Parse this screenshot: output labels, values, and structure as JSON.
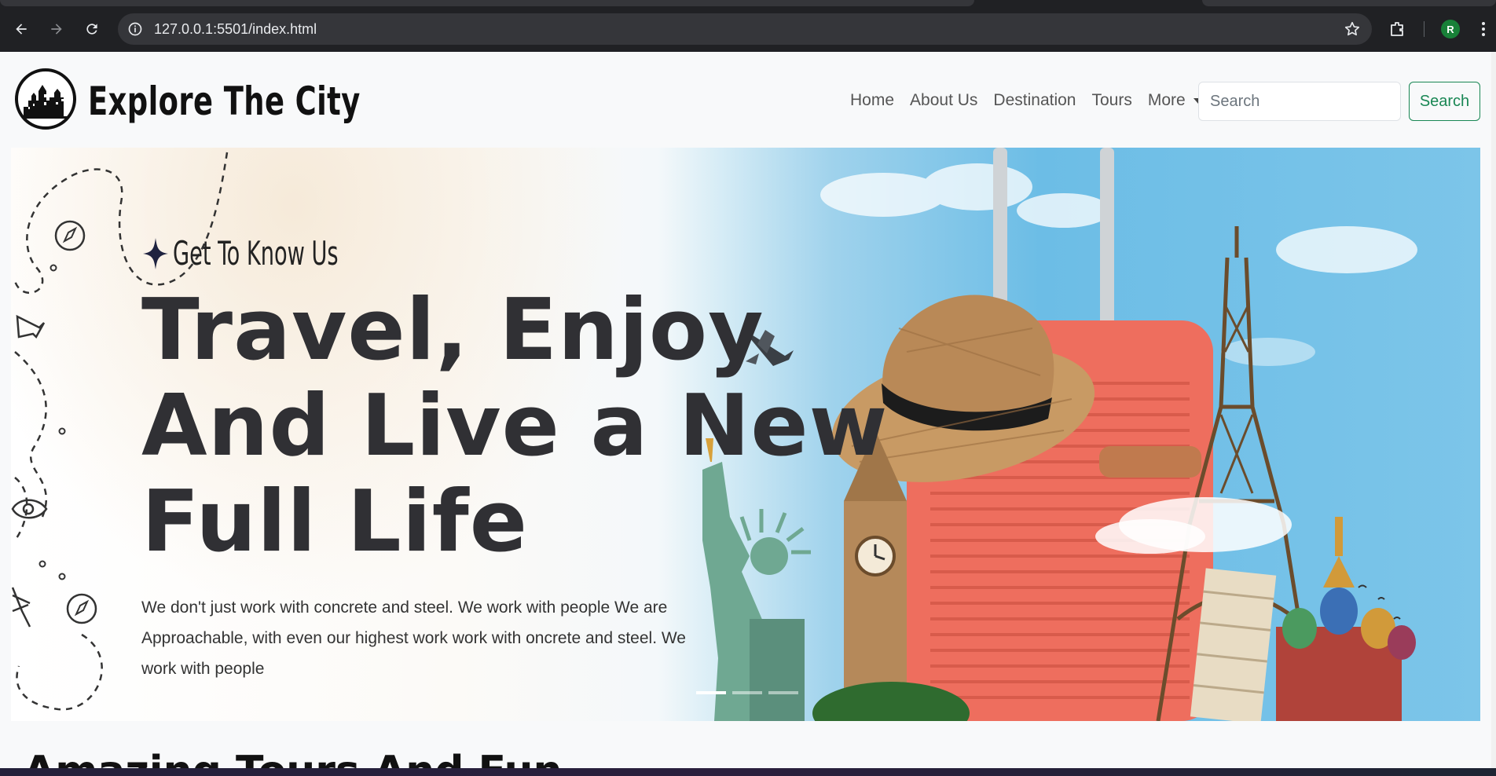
{
  "browser": {
    "url": "127.0.0.1:5501/index.html",
    "profile_initial": "R",
    "profile_color": "#188038"
  },
  "navbar": {
    "brand": "Explore The City",
    "links": [
      "Home",
      "About Us",
      "Destination",
      "Tours"
    ],
    "more_label": "More",
    "search_placeholder": "Search",
    "search_button": "Search",
    "accent_color": "#198754"
  },
  "hero": {
    "tagline": "Get To Know Us",
    "headline_lines": [
      "Travel, Enjoy",
      "And Live a New",
      "Full Life"
    ],
    "description": "We don't just work with concrete and steel. We work with people We are Approachable, with even our highest work work with oncrete and steel. We work with people",
    "slide_count": 3,
    "active_slide": 1
  },
  "next_section": {
    "title": "Amazing Tours And Fun"
  }
}
